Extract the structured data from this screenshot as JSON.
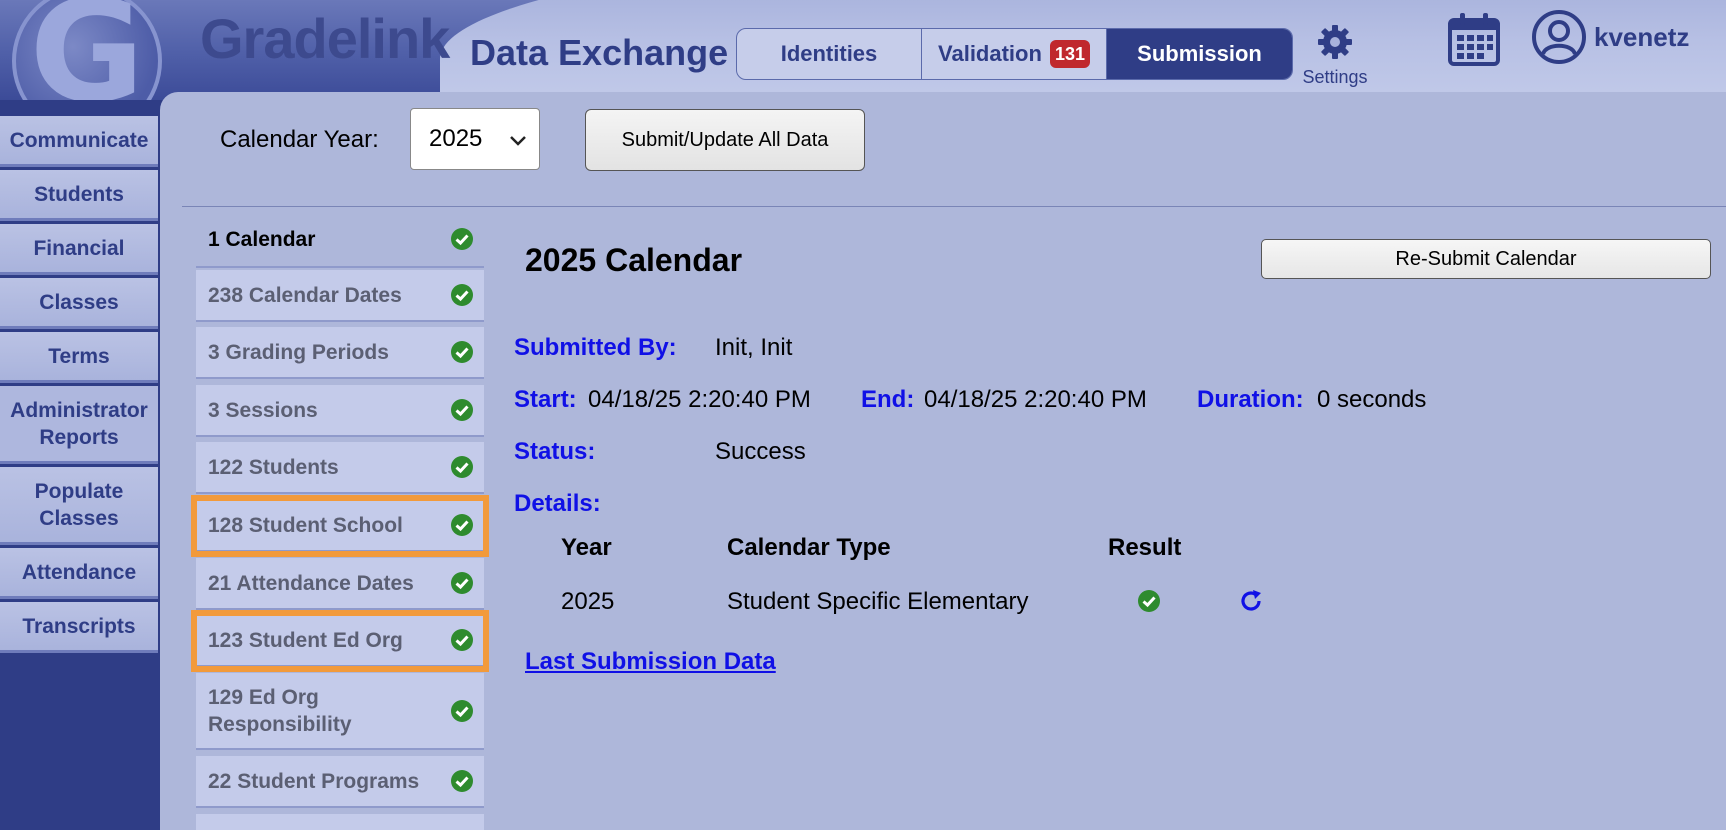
{
  "header": {
    "brand": "Gradelink",
    "app_title": "Data Exchange",
    "tabs": [
      {
        "label": "Identities"
      },
      {
        "label": "Validation",
        "badge": "131"
      },
      {
        "label": "Submission"
      }
    ],
    "settings_label": "Settings",
    "username": "kvenetz"
  },
  "sidebar": {
    "items": [
      {
        "label": "Communicate"
      },
      {
        "label": "Students"
      },
      {
        "label": "Financial"
      },
      {
        "label": "Classes"
      },
      {
        "label": "Terms"
      },
      {
        "label": "Administrator Reports"
      },
      {
        "label": "Populate Classes"
      },
      {
        "label": "Attendance"
      },
      {
        "label": "Transcripts"
      }
    ]
  },
  "toolbar": {
    "calendar_year_label": "Calendar Year:",
    "calendar_year_value": "2025",
    "submit_all_label": "Submit/Update All Data"
  },
  "sections": [
    {
      "label": "1 Calendar",
      "status": "success"
    },
    {
      "label": "238 Calendar Dates",
      "status": "success"
    },
    {
      "label": "3 Grading Periods",
      "status": "success"
    },
    {
      "label": "3 Sessions",
      "status": "success"
    },
    {
      "label": "122 Students",
      "status": "success"
    },
    {
      "label": "128 Student School",
      "status": "success"
    },
    {
      "label": "21 Attendance Dates",
      "status": "success"
    },
    {
      "label": "123 Student Ed Org",
      "status": "success"
    },
    {
      "label": "129 Ed Org Responsibility",
      "status": "success"
    },
    {
      "label": "22 Student Programs",
      "status": "success"
    }
  ],
  "detail": {
    "title": "2025 Calendar",
    "resubmit_label": "Re-Submit Calendar",
    "submitted_by_label": "Submitted By:",
    "submitted_by_value": "Init, Init",
    "start_label": "Start:",
    "start_value": "04/18/25 2:20:40 PM",
    "end_label": "End:",
    "end_value": "04/18/25 2:20:40 PM",
    "duration_label": "Duration:",
    "duration_value": "0 seconds",
    "status_label": "Status:",
    "status_value": "Success",
    "details_label": "Details:",
    "table": {
      "headers": [
        "Year",
        "Calendar Type",
        "Result"
      ],
      "rows": [
        {
          "year": "2025",
          "calendar_type": "Student Specific Elementary",
          "result": "success"
        }
      ]
    },
    "last_submission_link": "Last Submission Data"
  },
  "colors": {
    "brand_dark": "#2f3d86",
    "label_blue": "#1010e6",
    "success_green": "#2e8b2e",
    "badge_red": "#c0282d",
    "highlight_orange": "#f29a3b"
  },
  "icons": [
    "gear-icon",
    "calendar-icon",
    "user-avatar-icon",
    "check-circle-icon",
    "refresh-icon",
    "chevron-down-icon"
  ]
}
